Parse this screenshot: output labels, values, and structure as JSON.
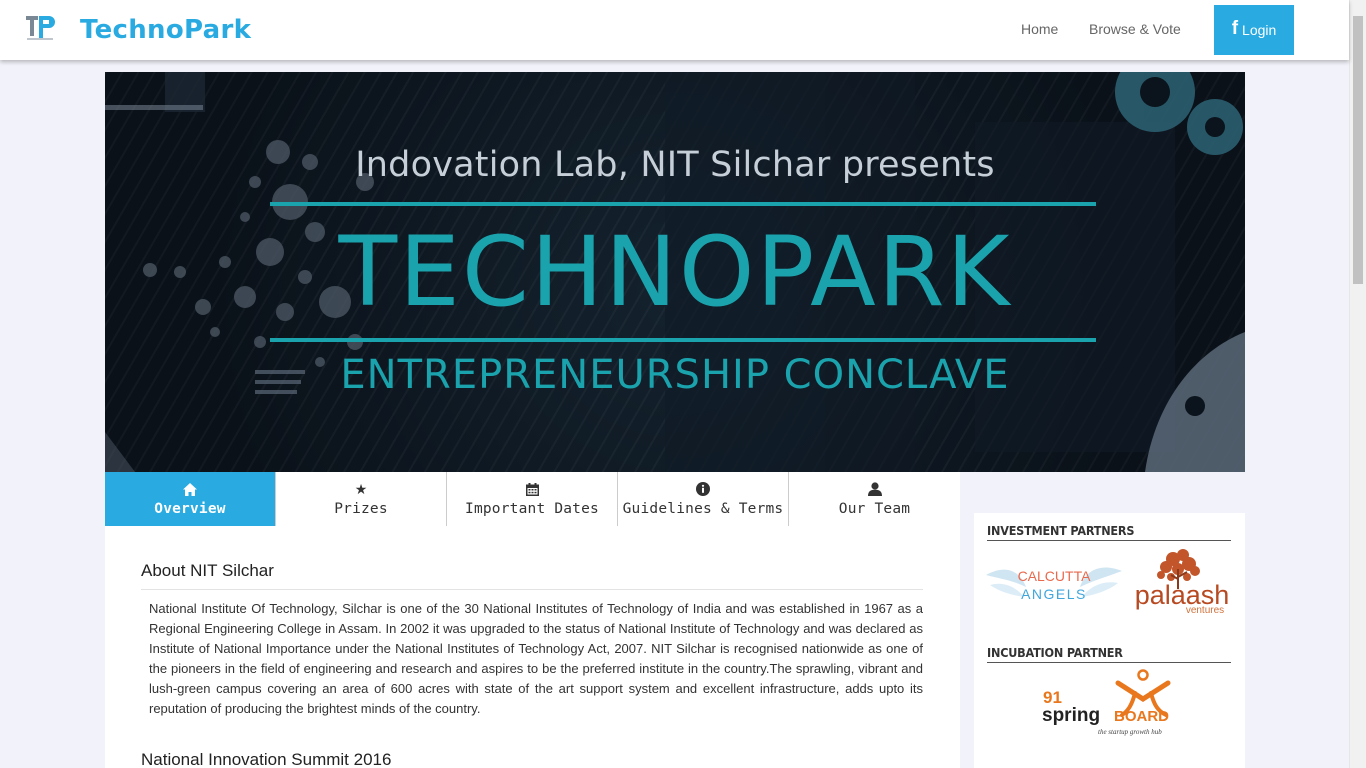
{
  "navbar": {
    "brand": "TechnoPark",
    "links": [
      "Home",
      "Browse & Vote"
    ],
    "login": {
      "icon": "facebook-icon",
      "label": "Login"
    }
  },
  "banner": {
    "presents": "Indovation Lab, NIT Silchar presents",
    "title": "TECHNOPARK",
    "subtitle": "ENTREPRENEURSHIP CONCLAVE"
  },
  "tabs": [
    {
      "label": "Overview",
      "icon": "home-icon",
      "active": true
    },
    {
      "label": "Prizes",
      "icon": "star-icon",
      "active": false
    },
    {
      "label": "Important Dates",
      "icon": "calendar-icon",
      "active": false
    },
    {
      "label": "Guidelines & Terms",
      "icon": "info-icon",
      "active": false
    },
    {
      "label": "Our Team",
      "icon": "user-icon",
      "active": false
    }
  ],
  "main": {
    "about_title": "About NIT Silchar",
    "about_body": "National Institute Of Technology, Silchar is one of the 30 National Institutes of Technology of India and was established in 1967 as a Regional Engineering College in Assam. In 2002 it was upgraded to the status of National Institute of Technology and was declared as Institute of National Importance under the National Institutes of Technology Act, 2007. NIT Silchar is recognised nationwide as one of the pioneers in the field of engineering and research and aspires to be the preferred institute in the country.The sprawling, vibrant and lush-green campus covering an area of 600 acres with state of the art support system and excellent infrastructure, adds upto its reputation of producing the brightest minds of the country.",
    "summit_title": "National Innovation Summit 2016"
  },
  "sidebar": {
    "investment_heading": "INVESTMENT PARTNERS",
    "incubation_heading": "INCUBATION PARTNER",
    "calcutta_line1": "CALCUTTA",
    "calcutta_line2": "ANGELS",
    "palaash_main": "palaash",
    "palaash_sub": "ventures",
    "spring_num": "91",
    "spring_word": "spring",
    "spring_board": "BOARD",
    "spring_tag": "the startup growth hub"
  },
  "colors": {
    "accent": "#29aae1",
    "banner_teal": "#1aa3ad",
    "palaash": "#b84a22",
    "springboard_orange": "#e8771e"
  }
}
